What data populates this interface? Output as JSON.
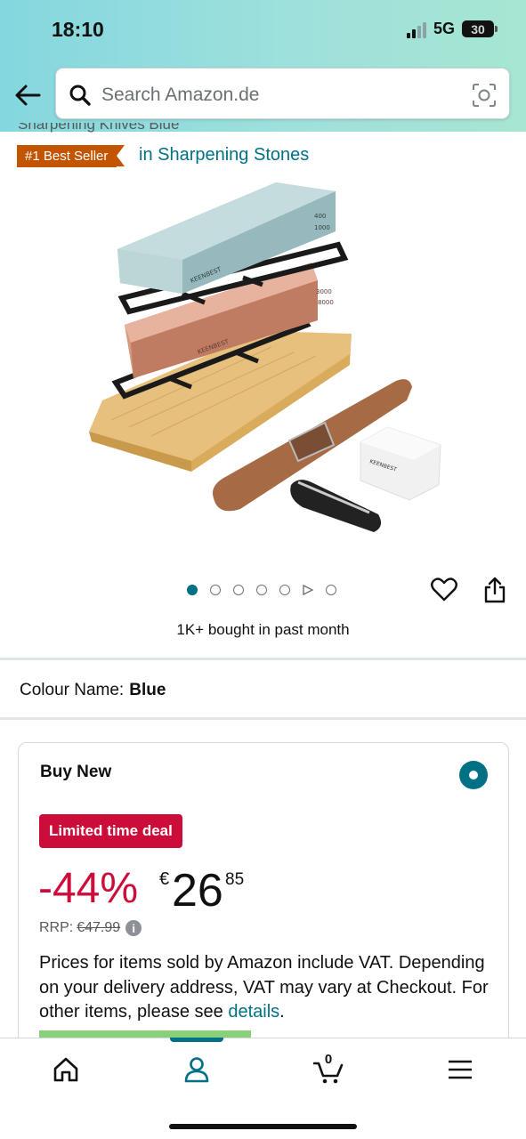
{
  "status_bar": {
    "time": "18:10",
    "network": "5G",
    "battery": "30"
  },
  "search": {
    "placeholder": "Search Amazon.de"
  },
  "product": {
    "title_fragment": "Sharpening Knives Blue",
    "badge": "#1 Best Seller",
    "badge_category": "in Sharpening Stones",
    "image_stone_grit_top": [
      "400",
      "1000"
    ],
    "image_stone_grit_bottom": [
      "3000",
      "8000"
    ],
    "image_brand": "KEENBEST",
    "gallery": {
      "total": 7,
      "active": 0,
      "video_index": 5
    },
    "bought_text": "1K+ bought in past month"
  },
  "variant": {
    "label": "Colour Name:",
    "value": "Blue"
  },
  "buy_box": {
    "title": "Buy New",
    "deal_badge": "Limited time deal",
    "discount": "-44%",
    "currency": "€",
    "price_whole": "26",
    "price_fraction": "85",
    "rrp_label": "RRP:",
    "rrp_value": "€47.99",
    "vat_text": "Prices for items sold by Amazon include VAT. Depending on your delivery address, VAT may vary at Checkout. For other items, please see ",
    "vat_link": "details",
    "vat_end": "."
  },
  "bottom_nav": {
    "cart_count": "0",
    "items": [
      "home-icon",
      "account-icon",
      "cart-icon",
      "menu-icon"
    ],
    "active": 1
  },
  "colors": {
    "accent": "#007185",
    "deal": "#cc0c39",
    "badge": "#c45500"
  }
}
